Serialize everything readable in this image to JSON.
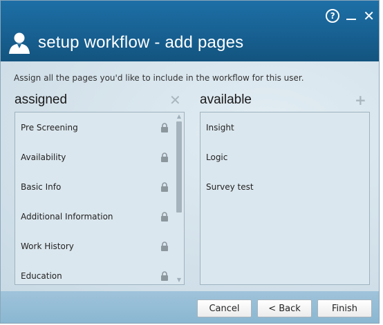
{
  "window": {
    "title": "setup workflow - add pages",
    "help_label": "?",
    "close_label": "✕"
  },
  "instructions": "Assign all the pages you'd like to include in the workflow for this user.",
  "assigned": {
    "heading": "assigned",
    "clear_icon": "close-icon",
    "items": [
      {
        "label": "Pre Screening",
        "locked": true
      },
      {
        "label": "Availability",
        "locked": true
      },
      {
        "label": "Basic Info",
        "locked": true
      },
      {
        "label": "Additional Information",
        "locked": true
      },
      {
        "label": "Work History",
        "locked": true
      },
      {
        "label": "Education",
        "locked": true
      }
    ]
  },
  "available": {
    "heading": "available",
    "add_icon": "plus-icon",
    "items": [
      {
        "label": "Insight"
      },
      {
        "label": "Logic"
      },
      {
        "label": "Survey test"
      }
    ]
  },
  "buttons": {
    "cancel": "Cancel",
    "back": "< Back",
    "finish": "Finish"
  },
  "colors": {
    "header": "#1a679b",
    "body": "#d6e4ec",
    "footer": "#94bdd6"
  }
}
